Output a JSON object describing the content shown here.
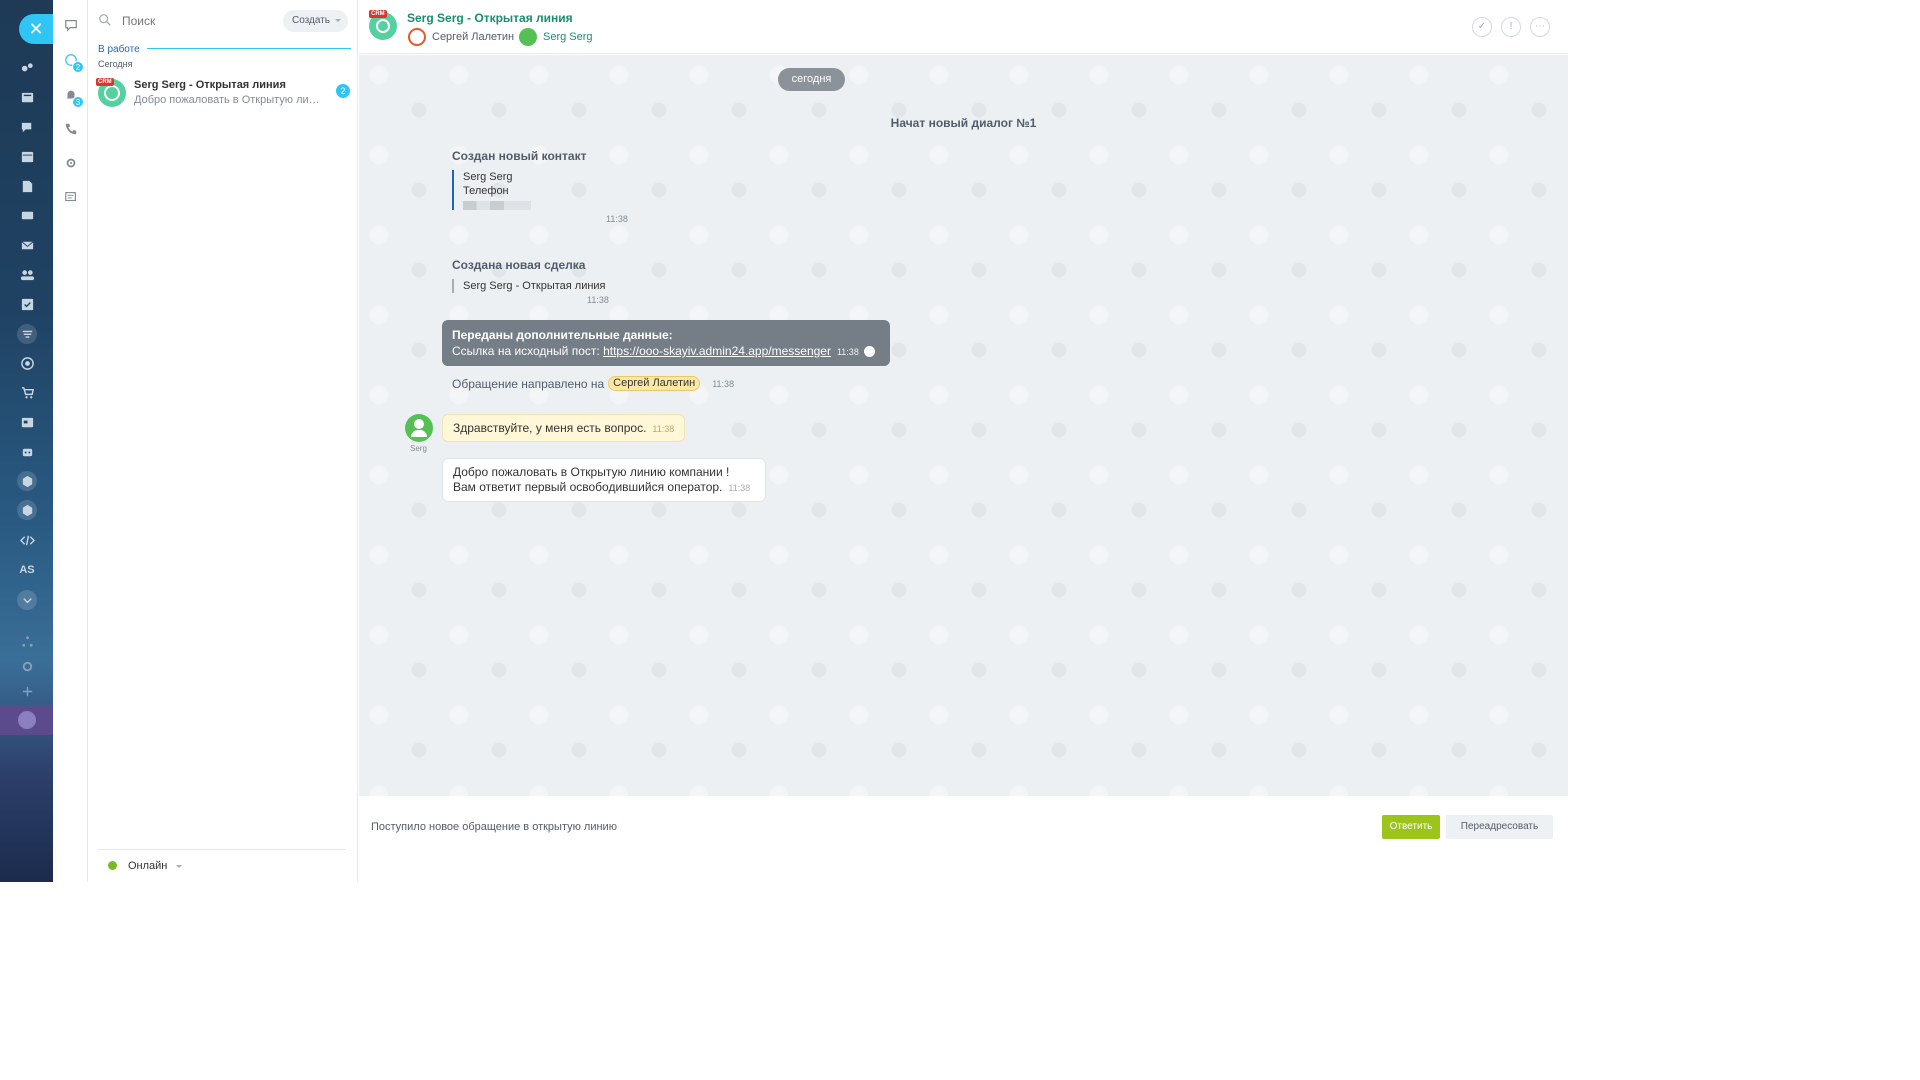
{
  "colors": {
    "accent": "#2fc6f6",
    "green_button": "#9dc41a",
    "header_link": "#1a8f6d",
    "crm_tag": "#d7372f"
  },
  "rail": {
    "close_icon": "close-icon",
    "items": [
      "activity-stream-icon",
      "feed-icon",
      "chat-icon",
      "calendar-icon",
      "documents-icon",
      "drive-icon",
      "mail-icon",
      "groups-icon",
      "tasks-icon",
      "crm-icon",
      "goals-icon",
      "shop-icon",
      "contact-center-icon",
      "robots-icon",
      "apps-icon",
      "market-icon",
      "developer-icon"
    ],
    "as_label": "AS"
  },
  "tools": {
    "items": [
      {
        "icon": "chat-bubble-icon",
        "badge": ""
      },
      {
        "icon": "open-lines-icon",
        "badge": "2"
      },
      {
        "icon": "notifications-icon",
        "badge": "3"
      },
      {
        "icon": "phone-icon",
        "badge": ""
      },
      {
        "icon": "settings-icon",
        "badge": ""
      },
      {
        "icon": "tasks-list-icon",
        "badge": ""
      }
    ]
  },
  "list": {
    "search_placeholder": "Поиск",
    "create_label": "Создать",
    "section_label": "В работе",
    "section_date": "Сегодня",
    "chats": [
      {
        "crm": "CRM",
        "title": "Serg Serg - Открытая линия",
        "preview": "Добро пожаловать в Открытую линию компании !",
        "count": "2"
      }
    ],
    "status_label": "Онлайн"
  },
  "header": {
    "crm": "CRM",
    "title": "Serg Serg - Открытая линия",
    "operator": "Сергей Лалетин",
    "client": "Serg Serg"
  },
  "chat": {
    "date_pill": "сегодня",
    "dialog_start": "Начат новый диалог №1",
    "contact_block": {
      "title": "Создан новый контакт",
      "name": "Serg Serg",
      "field": "Телефон",
      "time": "11:38"
    },
    "deal_block": {
      "title": "Создана новая сделка",
      "name": "Serg Serg - Открытая линия",
      "time": "11:38"
    },
    "extra_data": {
      "title": "Переданы дополнительные данные:",
      "prefix": "Ссылка на исходный пост: ",
      "link": "https://ooo-skayiv.admin24.app/messenger",
      "time": "11:38"
    },
    "forward": {
      "text": "Обращение направлено на",
      "name": "Сергей Лалетин",
      "time": "11:38"
    },
    "client_name": "Serg",
    "client_message": {
      "text": "Здравствуйте, у меня есть вопрос.",
      "time": "11:38"
    },
    "welcome": {
      "line1": "Добро пожаловать в Открытую линию компании !",
      "line2": "Вам ответит первый освободившийся оператор.",
      "time": "11:38"
    }
  },
  "footer": {
    "message": "Поступило новое обращение в открытую линию",
    "answer_label": "Ответить",
    "forward_label": "Переадресовать"
  }
}
